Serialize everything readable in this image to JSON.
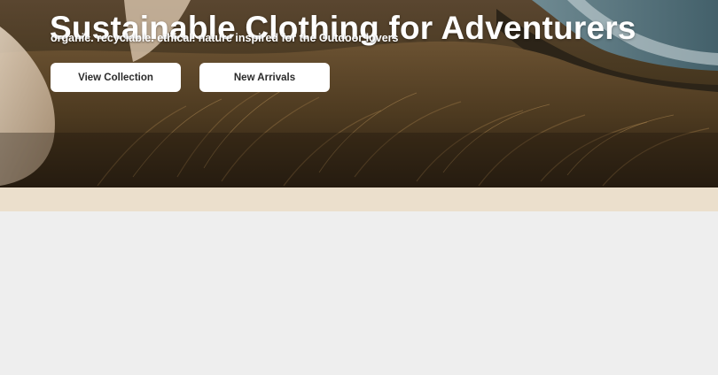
{
  "hero": {
    "title": "Sustainable Clothing for Adventurers",
    "subtitle": "organic. recyclable. ethical. nature inspired for the Outdoor lovers",
    "buttons": {
      "view_collection": "View Collection",
      "new_arrivals": "New Arrivals"
    }
  },
  "colors": {
    "band": "#ebdfcc",
    "page_background": "#eeeeee",
    "button_background": "#ffffff",
    "button_text": "#2a2a2a"
  }
}
